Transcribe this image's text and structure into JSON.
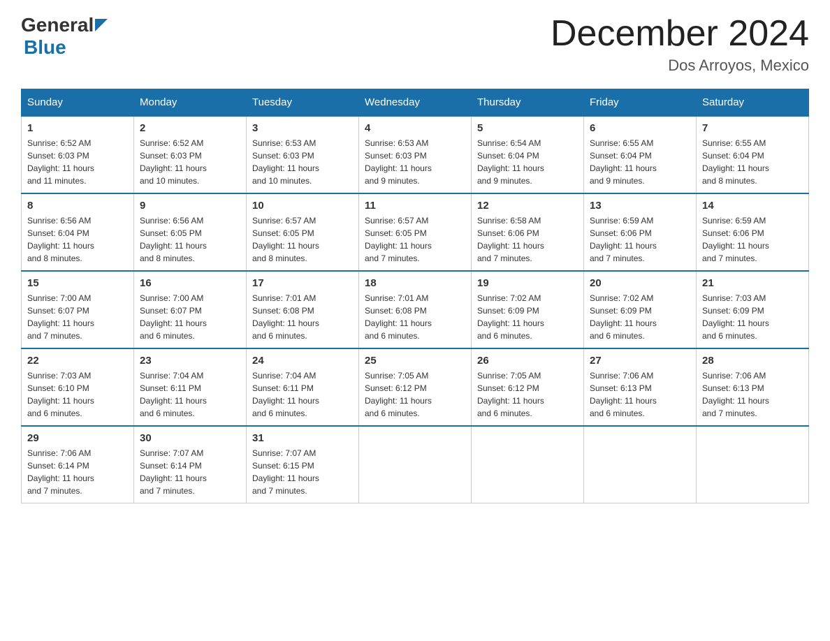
{
  "header": {
    "logo": {
      "general": "General",
      "blue": "Blue"
    },
    "title": "December 2024",
    "location": "Dos Arroyos, Mexico"
  },
  "calendar": {
    "days_of_week": [
      "Sunday",
      "Monday",
      "Tuesday",
      "Wednesday",
      "Thursday",
      "Friday",
      "Saturday"
    ],
    "weeks": [
      [
        {
          "day": "1",
          "info": "Sunrise: 6:52 AM\nSunset: 6:03 PM\nDaylight: 11 hours\nand 11 minutes."
        },
        {
          "day": "2",
          "info": "Sunrise: 6:52 AM\nSunset: 6:03 PM\nDaylight: 11 hours\nand 10 minutes."
        },
        {
          "day": "3",
          "info": "Sunrise: 6:53 AM\nSunset: 6:03 PM\nDaylight: 11 hours\nand 10 minutes."
        },
        {
          "day": "4",
          "info": "Sunrise: 6:53 AM\nSunset: 6:03 PM\nDaylight: 11 hours\nand 9 minutes."
        },
        {
          "day": "5",
          "info": "Sunrise: 6:54 AM\nSunset: 6:04 PM\nDaylight: 11 hours\nand 9 minutes."
        },
        {
          "day": "6",
          "info": "Sunrise: 6:55 AM\nSunset: 6:04 PM\nDaylight: 11 hours\nand 9 minutes."
        },
        {
          "day": "7",
          "info": "Sunrise: 6:55 AM\nSunset: 6:04 PM\nDaylight: 11 hours\nand 8 minutes."
        }
      ],
      [
        {
          "day": "8",
          "info": "Sunrise: 6:56 AM\nSunset: 6:04 PM\nDaylight: 11 hours\nand 8 minutes."
        },
        {
          "day": "9",
          "info": "Sunrise: 6:56 AM\nSunset: 6:05 PM\nDaylight: 11 hours\nand 8 minutes."
        },
        {
          "day": "10",
          "info": "Sunrise: 6:57 AM\nSunset: 6:05 PM\nDaylight: 11 hours\nand 8 minutes."
        },
        {
          "day": "11",
          "info": "Sunrise: 6:57 AM\nSunset: 6:05 PM\nDaylight: 11 hours\nand 7 minutes."
        },
        {
          "day": "12",
          "info": "Sunrise: 6:58 AM\nSunset: 6:06 PM\nDaylight: 11 hours\nand 7 minutes."
        },
        {
          "day": "13",
          "info": "Sunrise: 6:59 AM\nSunset: 6:06 PM\nDaylight: 11 hours\nand 7 minutes."
        },
        {
          "day": "14",
          "info": "Sunrise: 6:59 AM\nSunset: 6:06 PM\nDaylight: 11 hours\nand 7 minutes."
        }
      ],
      [
        {
          "day": "15",
          "info": "Sunrise: 7:00 AM\nSunset: 6:07 PM\nDaylight: 11 hours\nand 7 minutes."
        },
        {
          "day": "16",
          "info": "Sunrise: 7:00 AM\nSunset: 6:07 PM\nDaylight: 11 hours\nand 6 minutes."
        },
        {
          "day": "17",
          "info": "Sunrise: 7:01 AM\nSunset: 6:08 PM\nDaylight: 11 hours\nand 6 minutes."
        },
        {
          "day": "18",
          "info": "Sunrise: 7:01 AM\nSunset: 6:08 PM\nDaylight: 11 hours\nand 6 minutes."
        },
        {
          "day": "19",
          "info": "Sunrise: 7:02 AM\nSunset: 6:09 PM\nDaylight: 11 hours\nand 6 minutes."
        },
        {
          "day": "20",
          "info": "Sunrise: 7:02 AM\nSunset: 6:09 PM\nDaylight: 11 hours\nand 6 minutes."
        },
        {
          "day": "21",
          "info": "Sunrise: 7:03 AM\nSunset: 6:09 PM\nDaylight: 11 hours\nand 6 minutes."
        }
      ],
      [
        {
          "day": "22",
          "info": "Sunrise: 7:03 AM\nSunset: 6:10 PM\nDaylight: 11 hours\nand 6 minutes."
        },
        {
          "day": "23",
          "info": "Sunrise: 7:04 AM\nSunset: 6:11 PM\nDaylight: 11 hours\nand 6 minutes."
        },
        {
          "day": "24",
          "info": "Sunrise: 7:04 AM\nSunset: 6:11 PM\nDaylight: 11 hours\nand 6 minutes."
        },
        {
          "day": "25",
          "info": "Sunrise: 7:05 AM\nSunset: 6:12 PM\nDaylight: 11 hours\nand 6 minutes."
        },
        {
          "day": "26",
          "info": "Sunrise: 7:05 AM\nSunset: 6:12 PM\nDaylight: 11 hours\nand 6 minutes."
        },
        {
          "day": "27",
          "info": "Sunrise: 7:06 AM\nSunset: 6:13 PM\nDaylight: 11 hours\nand 6 minutes."
        },
        {
          "day": "28",
          "info": "Sunrise: 7:06 AM\nSunset: 6:13 PM\nDaylight: 11 hours\nand 7 minutes."
        }
      ],
      [
        {
          "day": "29",
          "info": "Sunrise: 7:06 AM\nSunset: 6:14 PM\nDaylight: 11 hours\nand 7 minutes."
        },
        {
          "day": "30",
          "info": "Sunrise: 7:07 AM\nSunset: 6:14 PM\nDaylight: 11 hours\nand 7 minutes."
        },
        {
          "day": "31",
          "info": "Sunrise: 7:07 AM\nSunset: 6:15 PM\nDaylight: 11 hours\nand 7 minutes."
        },
        {
          "day": "",
          "info": ""
        },
        {
          "day": "",
          "info": ""
        },
        {
          "day": "",
          "info": ""
        },
        {
          "day": "",
          "info": ""
        }
      ]
    ]
  }
}
